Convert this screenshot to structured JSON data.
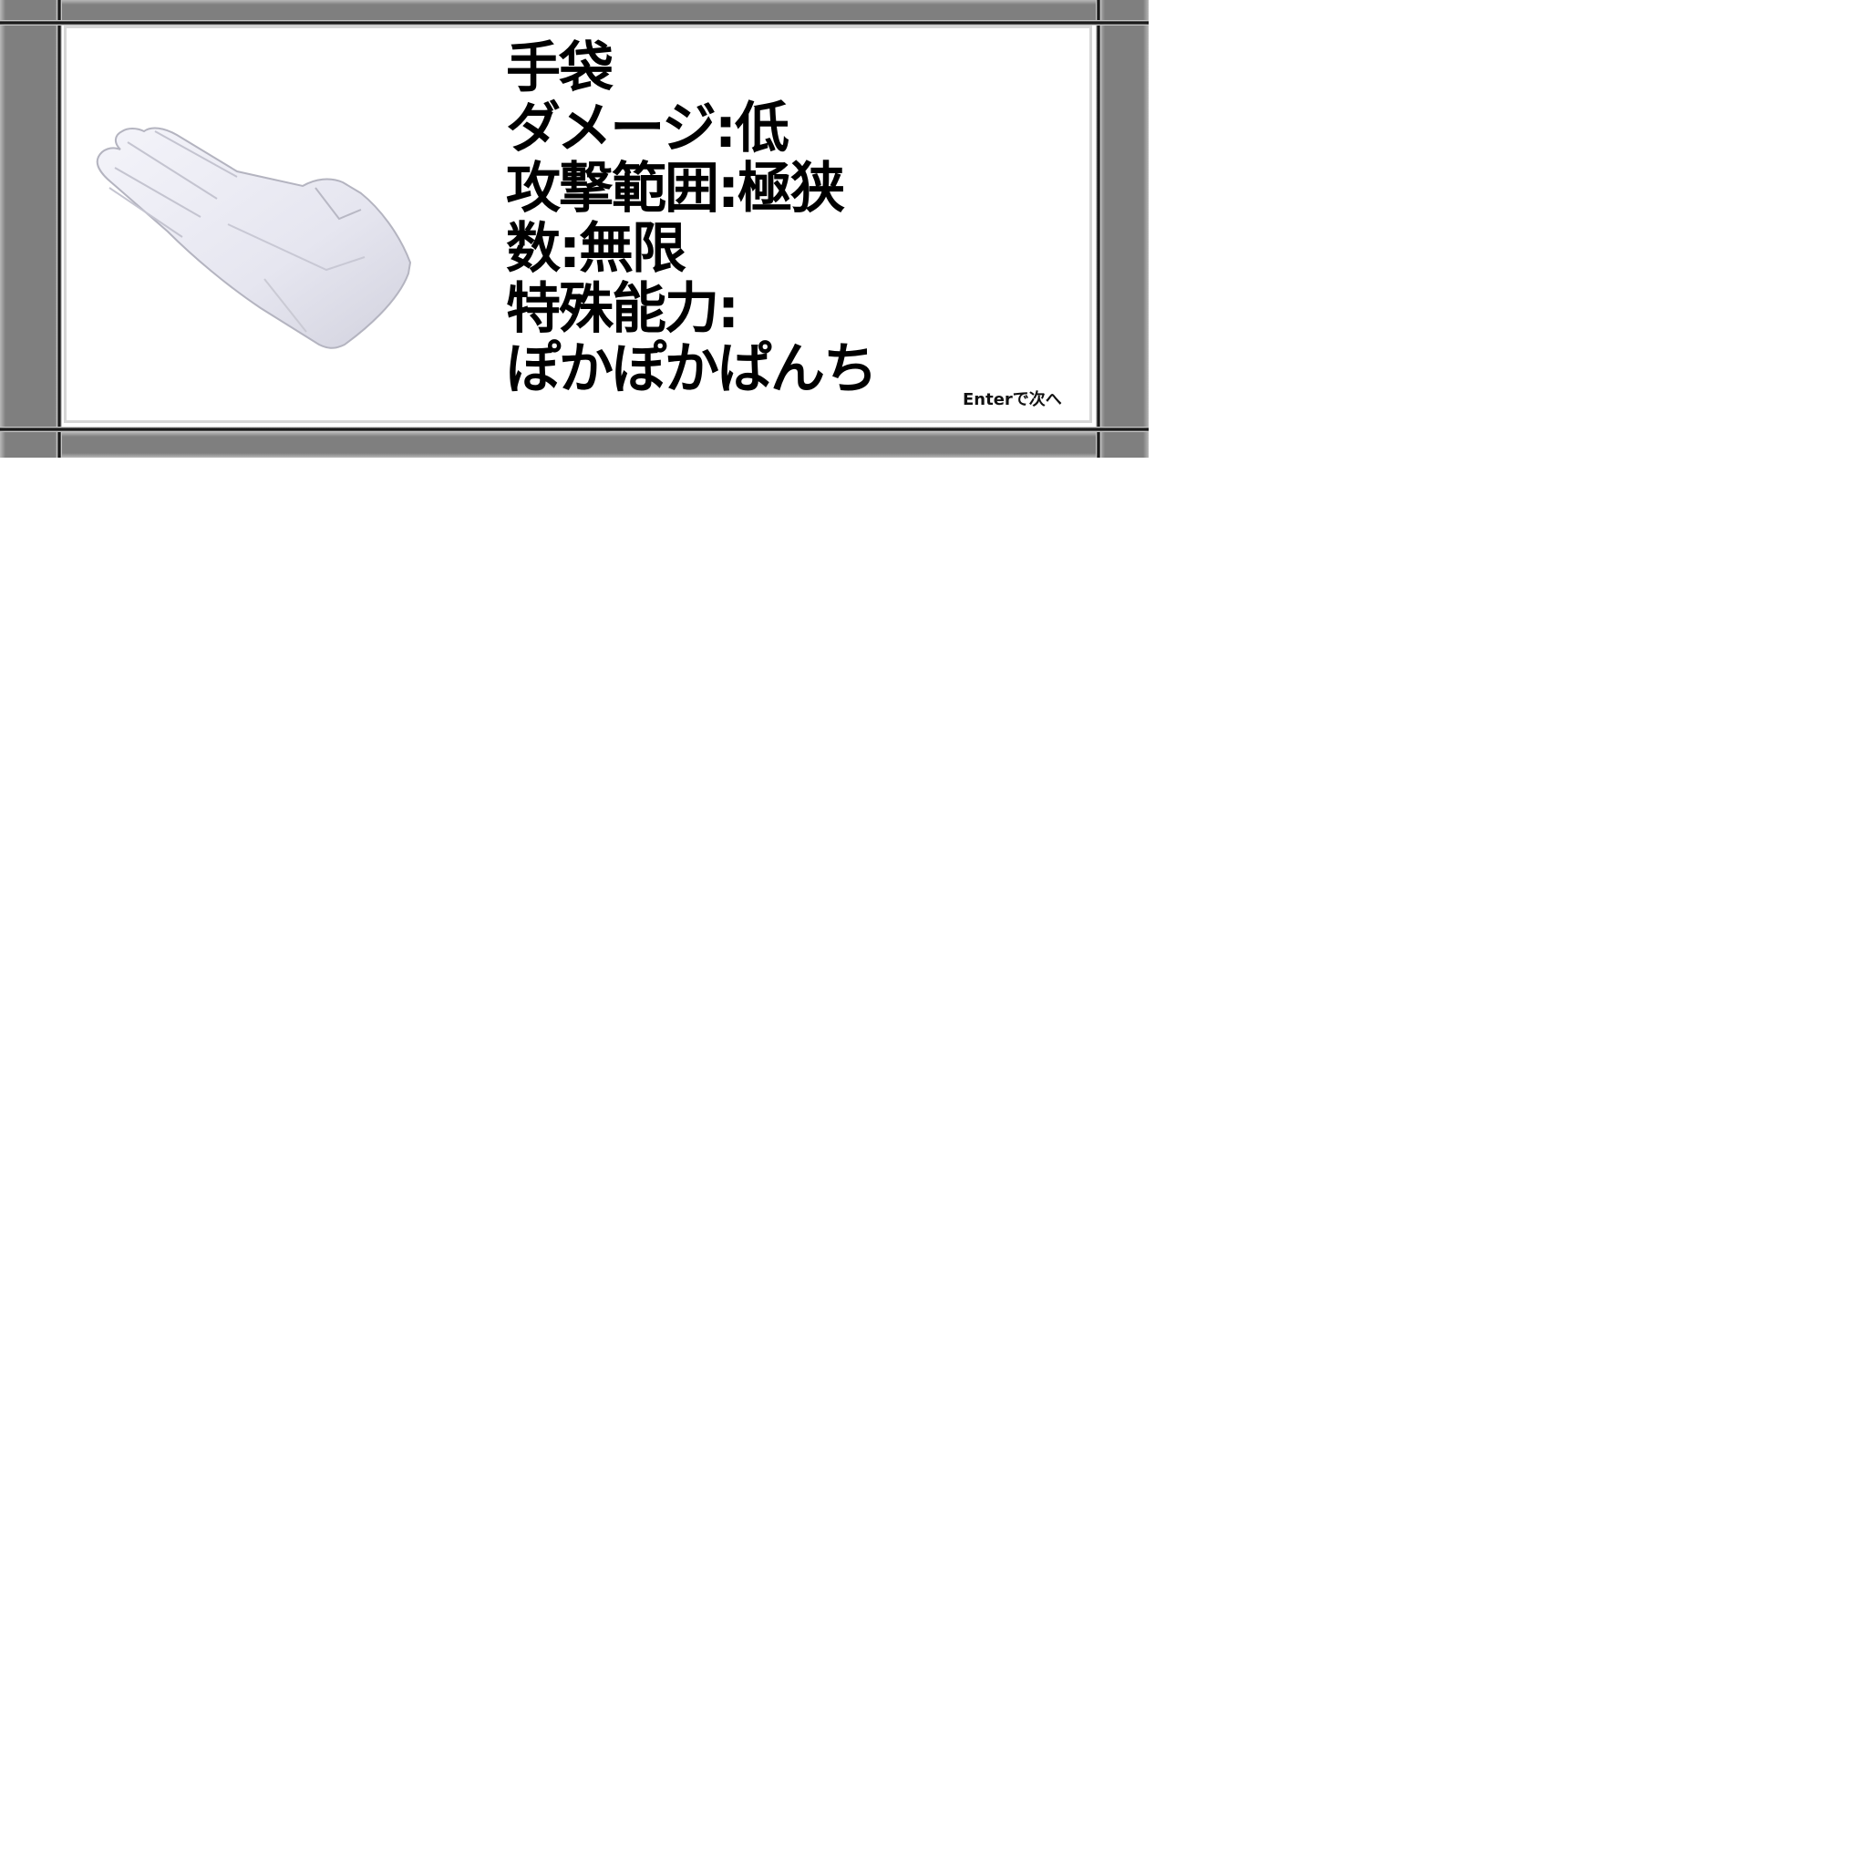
{
  "weapon": {
    "name": "手袋",
    "damage": "ダメージ:低",
    "range": "攻撃範囲:極狭",
    "count": "数:無限",
    "special_label": "特殊能力:",
    "special_value": "ぽかぽかぱんち"
  },
  "hint": "Enterで次へ",
  "image": {
    "icon": "white-glove-icon"
  },
  "colors": {
    "frame": "#7f7f7f",
    "panel": "#ffffff",
    "text": "#000000"
  }
}
